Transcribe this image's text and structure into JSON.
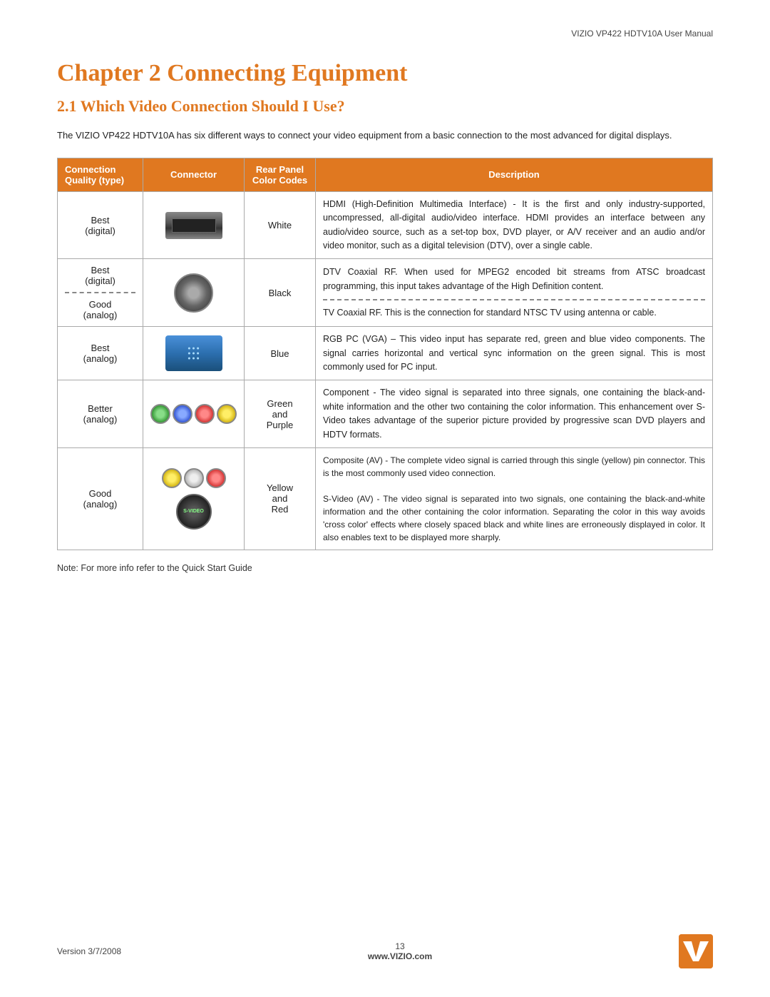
{
  "header": {
    "title": "VIZIO VP422 HDTV10A User Manual"
  },
  "chapter": {
    "title": "Chapter 2  Connecting Equipment",
    "section": "2.1 Which Video Connection Should I Use?",
    "intro": "The VIZIO VP422 HDTV10A has six different ways to connect your video equipment from a basic connection to the most advanced for digital displays."
  },
  "table": {
    "headers": {
      "quality": "Connection Quality (type)",
      "connector": "Connector",
      "color": "Rear Panel Color Codes",
      "description": "Description"
    },
    "rows": [
      {
        "quality": "Best (digital)",
        "connector_type": "hdmi",
        "color": "White",
        "description": "HDMI (High-Definition Multimedia Interface) - It is the first and only industry-supported, uncompressed, all-digital audio/video interface. HDMI provides an interface between any audio/video source, such as a set-top box, DVD player, or A/V receiver and an audio and/or video monitor, such as a digital television (DTV), over a single cable."
      },
      {
        "quality": "Best (digital)\n\nGood (analog)",
        "connector_type": "coax",
        "color": "Black",
        "description_top": "DTV Coaxial RF.  When used for MPEG2 encoded bit streams from ATSC broadcast programming, this input takes advantage of the High Definition content.",
        "description_bottom": "TV Coaxial RF. This is the connection for standard NTSC TV using antenna or cable.",
        "has_divider": true
      },
      {
        "quality": "Best (analog)",
        "connector_type": "vga",
        "color": "Blue",
        "description": "RGB PC (VGA) – This video input has separate red, green and blue video components.   The signal carries horizontal and vertical sync information on the green signal.  This is most commonly used for PC input."
      },
      {
        "quality": "Better (analog)",
        "connector_type": "component",
        "color": "Green and Purple",
        "description": "Component - The video signal is separated into three signals, one containing the black-and-white information and the other two containing the color information. This enhancement over S-Video takes advantage of the superior picture provided by progressive scan DVD players and HDTV formats."
      },
      {
        "quality": "Good (analog)",
        "connector_type": "composite_svideo",
        "color": "Yellow and Red",
        "description": "Composite (AV) - The complete video signal is carried through this single (yellow) pin connector.  This is the most commonly used video connection.\n\nS-Video (AV) - The video signal is separated into two signals, one  containing  the  black-and-white information and the other containing the color information. Separating the color in this way avoids 'cross color' effects where closely spaced black and white lines are erroneously displayed in color.  It also enables text to be displayed more sharply."
      }
    ]
  },
  "note": "Note:  For more info refer to the Quick Start Guide",
  "footer": {
    "version": "Version 3/7/2008",
    "page": "13",
    "website": "www.VIZIO.com"
  }
}
